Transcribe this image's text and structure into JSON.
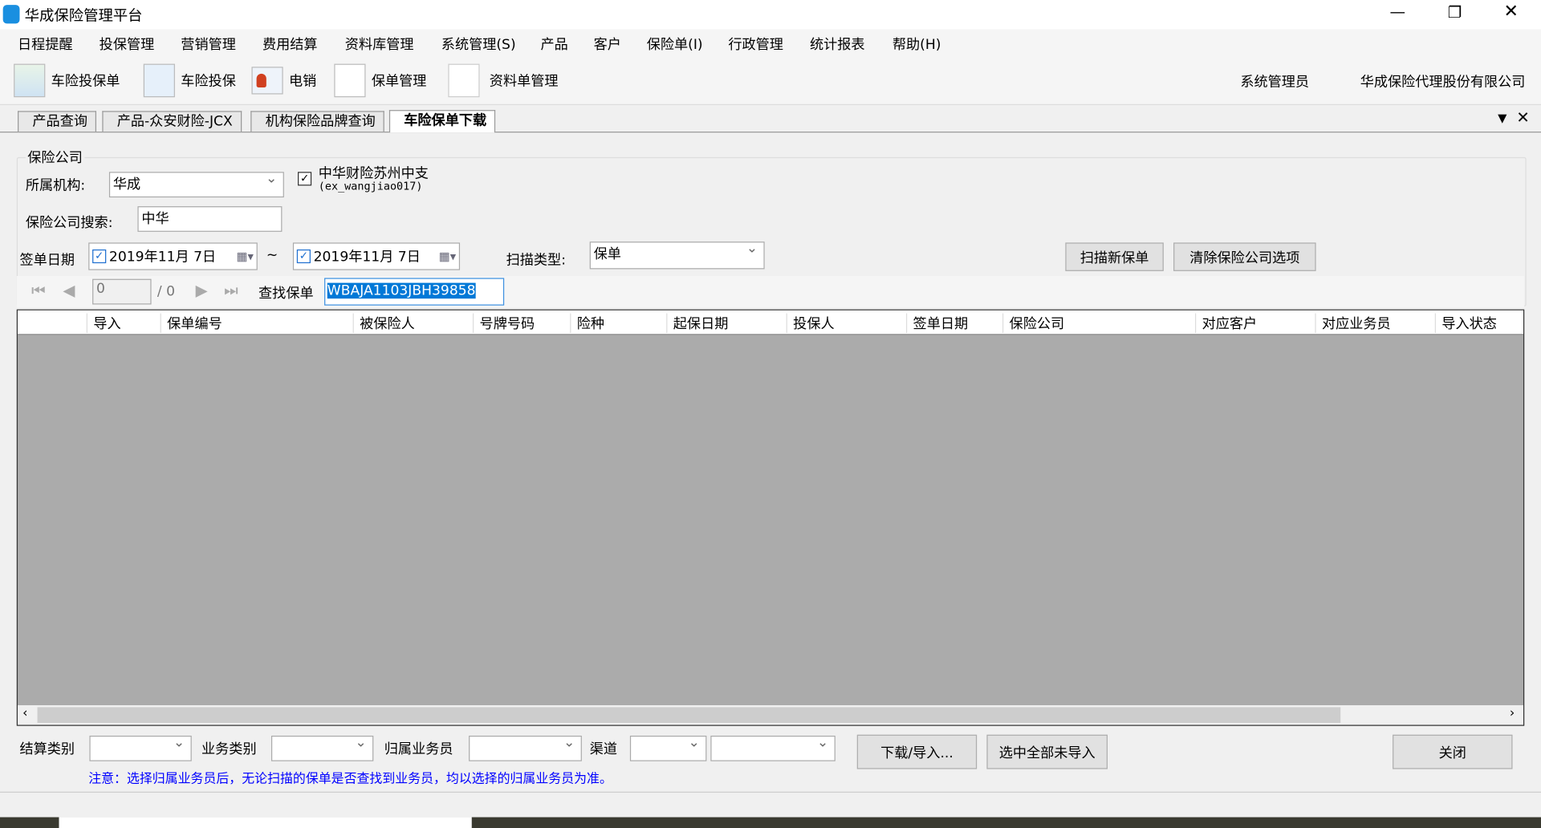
{
  "window": {
    "title": "华成保险管理平台",
    "controls": [
      "minimize",
      "restore",
      "close"
    ]
  },
  "menu": [
    "日程提醒",
    "投保管理",
    "营销管理",
    "费用结算",
    "资料库管理",
    "系统管理(S)",
    "产品",
    "客户",
    "保险单(I)",
    "行政管理",
    "统计报表",
    "帮助(H)"
  ],
  "toolbar": {
    "items": [
      {
        "label": "车险投保单",
        "icon": "spreadsheet-icon"
      },
      {
        "label": "车险投保",
        "icon": "document-pen-icon"
      },
      {
        "label": "电销",
        "icon": "contact-card-icon"
      },
      {
        "label": "保单管理",
        "icon": "list-pen-icon"
      },
      {
        "label": "资料单管理",
        "icon": "blank-document-icon"
      }
    ],
    "user": "系统管理员",
    "company": "华成保险代理股份有限公司"
  },
  "tabs": [
    {
      "label": "产品查询"
    },
    {
      "label": "产品-众安财险-JCX"
    },
    {
      "label": "机构保险品牌查询"
    },
    {
      "label": "车险保单下载",
      "active": true
    }
  ],
  "form": {
    "group_title": "保险公司",
    "org_label": "所属机构:",
    "org_value": "华成",
    "company_checked": true,
    "company_name": "中华财险苏州中支",
    "company_code": "(ex_wangjiao017)",
    "search_label": "保险公司搜索:",
    "search_value": "中华",
    "date_label": "签单日期",
    "date_from": "2019年11月 7日",
    "date_to": "2019年11月 7日",
    "date_sep": "~",
    "scan_type_label": "扫描类型:",
    "scan_type_value": "保单",
    "scan_button": "扫描新保单",
    "clear_button": "清除保险公司选项"
  },
  "nav": {
    "page_value": "0",
    "page_total": "/ 0",
    "find_label": "查找保单",
    "find_value": "WBAJA1103JBH39858"
  },
  "table": {
    "columns": [
      "导入",
      "保单编号",
      "被保险人",
      "号牌号码",
      "险种",
      "起保日期",
      "投保人",
      "签单日期",
      "保险公司",
      "对应客户",
      "对应业务员",
      "导入状态"
    ],
    "rows": []
  },
  "bottom": {
    "settle_label": "结算类别",
    "biz_label": "业务类别",
    "agent_label": "归属业务员",
    "channel_label": "渠道",
    "download_button": "下载/导入...",
    "select_all_button": "选中全部未导入",
    "close_button": "关闭",
    "notice": "注意：选择归属业务员后，无论扫描的保单是否查找到业务员，均以选择的归属业务员为准。",
    "notice_color": "#0000ff"
  }
}
